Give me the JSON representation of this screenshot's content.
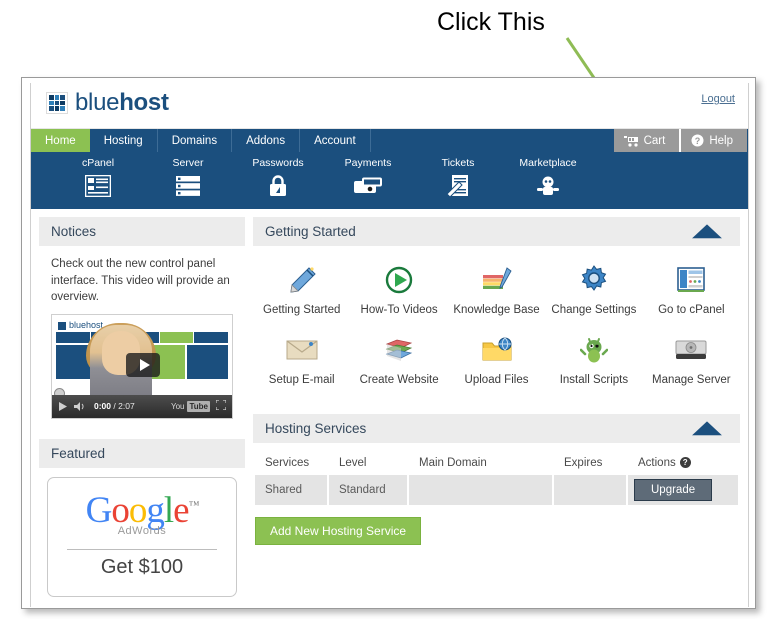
{
  "annotation": {
    "label": "Click This",
    "arrow_color": "#8fbc55",
    "points_to": "Go to cPanel"
  },
  "brand": {
    "name_light": "blue",
    "name_bold": "host",
    "logo_icon": "grid-squares-icon"
  },
  "header": {
    "logout_label": "Logout"
  },
  "nav": {
    "items": [
      {
        "label": "Home",
        "active": true
      },
      {
        "label": "Hosting",
        "active": false
      },
      {
        "label": "Domains",
        "active": false
      },
      {
        "label": "Addons",
        "active": false
      },
      {
        "label": "Account",
        "active": false
      }
    ],
    "buttons": [
      {
        "label": "Cart",
        "icon": "shopping-cart-icon"
      },
      {
        "label": "Help",
        "icon": "question-mark-circle-icon"
      }
    ],
    "active_color": "#8cc152",
    "bar_color": "#1b4f7e"
  },
  "subnav": {
    "items": [
      {
        "label": "cPanel",
        "icon": "cpanel-window-icon"
      },
      {
        "label": "Server",
        "icon": "server-stack-icon"
      },
      {
        "label": "Passwords",
        "icon": "padlock-icon"
      },
      {
        "label": "Payments",
        "icon": "wallet-icon"
      },
      {
        "label": "Tickets",
        "icon": "ticket-wrench-icon"
      },
      {
        "label": "Marketplace",
        "icon": "marketplace-robot-icon"
      }
    ]
  },
  "notices": {
    "title": "Notices",
    "text": "Check out the new control panel interface. This video will provide an overview.",
    "video": {
      "current_time": "0:00",
      "total_time": "2:07",
      "separator": "/",
      "provider": "You",
      "provider_badge": "Tube",
      "play_icon": "play-icon",
      "volume_icon": "volume-icon",
      "fullscreen_icon": "fullscreen-icon"
    }
  },
  "featured": {
    "title": "Featured",
    "ad": {
      "logo_letters": [
        "G",
        "o",
        "o",
        "g",
        "l",
        "e"
      ],
      "trademark": "™",
      "product": "AdWords",
      "offer": "Get $100"
    }
  },
  "getting_started": {
    "title": "Getting Started",
    "collapse_icon": "chevron-up-icon",
    "tiles": [
      {
        "label": "Getting Started",
        "icon": "wizard-hat-icon"
      },
      {
        "label": "How-To Videos",
        "icon": "play-circle-icon"
      },
      {
        "label": "Knowledge Base",
        "icon": "books-pencil-icon"
      },
      {
        "label": "Change Settings",
        "icon": "gear-icon"
      },
      {
        "label": "Go to cPanel",
        "icon": "cpanel-window-icon"
      },
      {
        "label": "Setup E-mail",
        "icon": "envelope-icon"
      },
      {
        "label": "Create Website",
        "icon": "stacked-books-icon"
      },
      {
        "label": "Upload Files",
        "icon": "folder-globe-icon"
      },
      {
        "label": "Install Scripts",
        "icon": "mojo-mascot-icon"
      },
      {
        "label": "Manage Server",
        "icon": "hard-drive-icon"
      }
    ]
  },
  "hosting_services": {
    "title": "Hosting Services",
    "collapse_icon": "chevron-up-icon",
    "columns": [
      "Services",
      "Level",
      "Main Domain",
      "Expires",
      "Actions"
    ],
    "actions_help_icon": "help-icon",
    "rows": [
      {
        "services": "Shared",
        "level": "Standard",
        "main_domain": "",
        "expires": "",
        "action_label": "Upgrade"
      }
    ],
    "add_button_label": "Add New Hosting Service"
  },
  "colors": {
    "brand_blue": "#1b4f7e",
    "accent_green": "#8cc152",
    "panel_header_gray": "#ececec",
    "table_cell_gray": "#e4e4e4",
    "upgrade_button": "#5e6b78"
  }
}
